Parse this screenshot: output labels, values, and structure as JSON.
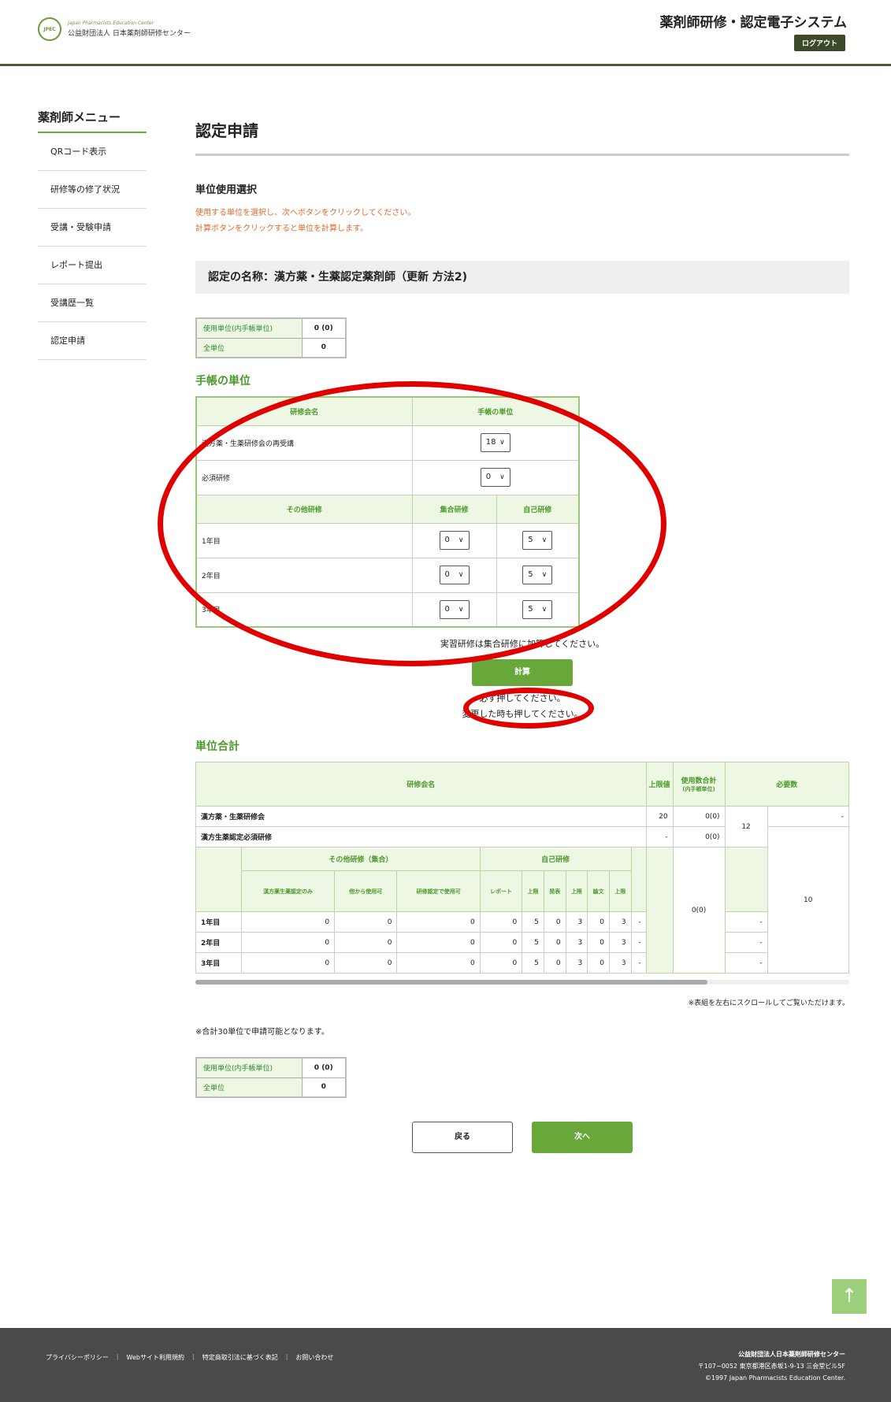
{
  "header": {
    "logo_mark": "JPEC",
    "logo_en": "Japan Pharmacists Education Center",
    "logo_ja": "公益財団法人 日本薬剤師研修センター",
    "system_title": "薬剤師研修・認定電子システム",
    "logout_label": "ログアウト"
  },
  "sidebar": {
    "title": "薬剤師メニュー",
    "items": [
      "QRコード表示",
      "研修等の修了状況",
      "受講・受験申請",
      "レポート提出",
      "受講歴一覧",
      "認定申請"
    ]
  },
  "main": {
    "page_title": "認定申請",
    "section_label": "単位使用選択",
    "notes": [
      "使用する単位を選択し、次へボタンをクリックしてください。",
      "計算ボタンをクリックすると単位を計算します。"
    ],
    "cert_name": "認定の名称：漢方薬・生薬認定薬剤師（更新 方法2)",
    "unit_summary": {
      "used_label": "使用単位(内手帳単位)",
      "used_value": "0 (0)",
      "total_label": "全単位",
      "total_value": "0"
    },
    "techo": {
      "heading": "手帳の単位",
      "col_course": "研修会名",
      "col_units": "手帳の単位",
      "rows": [
        {
          "label": "漢方薬・生薬研修会の再受講",
          "value": "18"
        },
        {
          "label": "必須研修",
          "value": "0"
        }
      ],
      "other_label": "その他研修",
      "col_group": "集合研修",
      "col_self": "自己研修",
      "year_rows": [
        {
          "label": "1年目",
          "group": "0",
          "self": "5"
        },
        {
          "label": "2年目",
          "group": "0",
          "self": "5"
        },
        {
          "label": "3年目",
          "group": "0",
          "self": "5"
        }
      ],
      "hint": "実習研修は集合研修に加算してください。",
      "calc_label": "計算",
      "calc_note1": "必ず押してください。",
      "calc_note2": "変更した時も押してください。"
    },
    "sum": {
      "heading": "単位合計",
      "col_course": "研修会名",
      "col_limit": "上限値",
      "col_used": "使用数合計",
      "col_used_sub": "(内手帳単位)",
      "col_required": "必要数",
      "row1": {
        "label": "漢方薬・生薬研修会",
        "limit": "20",
        "used": "0(0)",
        "req": "12",
        "extra": "-"
      },
      "row2": {
        "label": "漢方生薬認定必須研修",
        "limit": "-",
        "used": "0(0)"
      },
      "group_header": "その他研修（集合）",
      "self_header": "自己研修",
      "sub_headers": [
        "漢方薬生薬認定のみ",
        "他から使用可",
        "研修認定で使用可",
        "レポート",
        "上限",
        "発表",
        "上限",
        "論文",
        "上限"
      ],
      "years": [
        {
          "label": "1年目",
          "vals": [
            "0",
            "0",
            "0",
            "0",
            "5",
            "0",
            "3",
            "0",
            "3"
          ],
          "limit": "-",
          "extra": "-"
        },
        {
          "label": "2年目",
          "vals": [
            "0",
            "0",
            "0",
            "0",
            "5",
            "0",
            "3",
            "0",
            "3"
          ],
          "limit": "-",
          "extra": "-"
        },
        {
          "label": "3年目",
          "vals": [
            "0",
            "0",
            "0",
            "0",
            "5",
            "0",
            "3",
            "0",
            "3"
          ],
          "limit": "-",
          "extra": "-"
        }
      ],
      "year_used": "0(0)",
      "year_required": "10",
      "scroll_note": "※表組を左右にスクロールしてご覧いただけます。"
    },
    "apply_note": "※合計30単位で申請可能となります。",
    "back_label": "戻る",
    "next_label": "次へ"
  },
  "to_top_icon": "arrow-up-icon",
  "footer": {
    "links": [
      "プライバシーポリシー",
      "Webサイト利用規約",
      "特定商取引法に基づく表記",
      "お問い合わせ"
    ],
    "org": "公益財団法人日本薬剤師研修センター",
    "address": "〒107−0052 東京都港区赤坂1-9-13 三会堂ビル5F",
    "copyright": "©1997 Japan Pharmacists Education Center."
  }
}
